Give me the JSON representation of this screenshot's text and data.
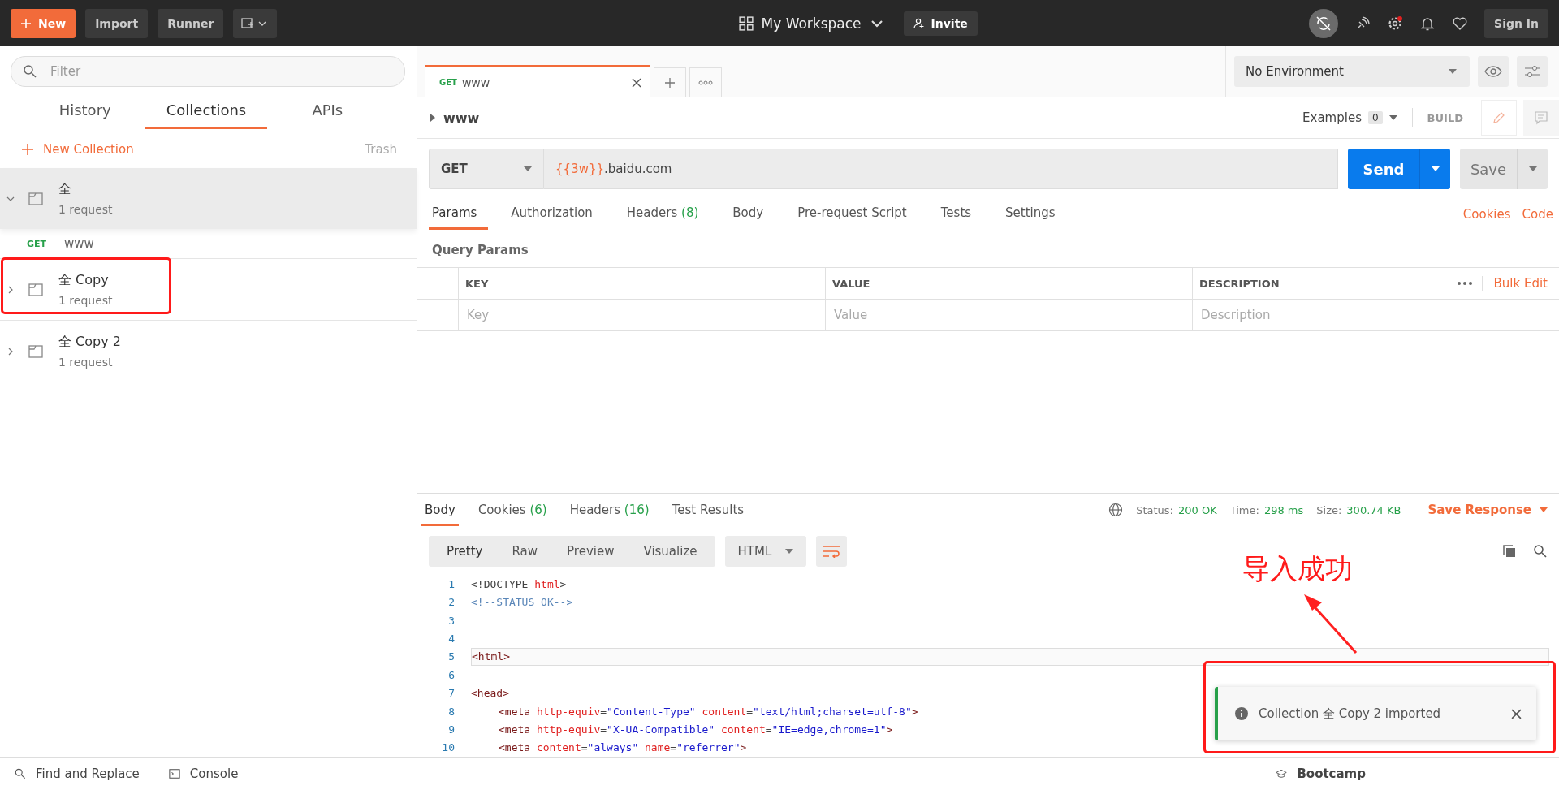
{
  "header": {
    "new_button": "New",
    "import_button": "Import",
    "runner_button": "Runner",
    "workspace": "My Workspace",
    "invite_button": "Invite",
    "sign_in_button": "Sign In"
  },
  "sidebar": {
    "filter_placeholder": "Filter",
    "tabs": [
      {
        "label": "History",
        "selected": false
      },
      {
        "label": "Collections",
        "selected": true
      },
      {
        "label": "APIs",
        "selected": false
      }
    ],
    "new_collection": "New Collection",
    "trash": "Trash",
    "collections": [
      {
        "name": "全",
        "count": "1 request",
        "expanded": true,
        "highlighted": false,
        "requests": [
          {
            "method": "GET",
            "name": "www"
          }
        ]
      },
      {
        "name": "全 Copy",
        "count": "1 request",
        "expanded": false,
        "highlighted": true
      },
      {
        "name": "全 Copy 2",
        "count": "1 request",
        "expanded": false,
        "highlighted": false
      }
    ]
  },
  "request_tabs": [
    {
      "method": "GET",
      "name": "www",
      "selected": true
    }
  ],
  "environment": "No Environment",
  "request": {
    "name": "www",
    "examples_label": "Examples",
    "examples_count": "0",
    "build_label": "BUILD",
    "method": "GET",
    "url_variable": "{{3w}}",
    "url_rest": ".baidu.com",
    "send": "Send",
    "save": "Save"
  },
  "request_sections": [
    {
      "label": "Params",
      "selected": true
    },
    {
      "label": "Authorization",
      "selected": false
    },
    {
      "label": "Headers",
      "count": "(8)",
      "selected": false
    },
    {
      "label": "Body",
      "selected": false
    },
    {
      "label": "Pre-request Script",
      "selected": false
    },
    {
      "label": "Tests",
      "selected": false
    },
    {
      "label": "Settings",
      "selected": false
    }
  ],
  "side_links": [
    "Cookies",
    "Code"
  ],
  "query_params": {
    "title": "Query Params",
    "columns": [
      "KEY",
      "VALUE",
      "DESCRIPTION"
    ],
    "bulk_edit": "Bulk Edit",
    "placeholders": [
      "Key",
      "Value",
      "Description"
    ]
  },
  "response": {
    "tabs": [
      {
        "label": "Body",
        "selected": true
      },
      {
        "label": "Cookies",
        "count": "(6)",
        "selected": false
      },
      {
        "label": "Headers",
        "count": "(16)",
        "selected": false
      },
      {
        "label": "Test Results",
        "selected": false
      }
    ],
    "status_label": "Status:",
    "status": "200 OK",
    "time_label": "Time:",
    "time": "298 ms",
    "size_label": "Size:",
    "size": "300.74 KB",
    "save_response": "Save Response",
    "view_modes": [
      {
        "label": "Pretty",
        "selected": true
      },
      {
        "label": "Raw",
        "selected": false
      },
      {
        "label": "Preview",
        "selected": false
      },
      {
        "label": "Visualize",
        "selected": false
      }
    ],
    "language": "HTML",
    "code_lines": [
      {
        "number": "1",
        "indent": false,
        "highlighted": false,
        "tokens": [
          {
            "kind": "punct",
            "text": "<!DOCTYPE "
          },
          {
            "kind": "keyword",
            "text": "html"
          },
          {
            "kind": "punct",
            "text": ">"
          }
        ]
      },
      {
        "number": "2",
        "indent": false,
        "highlighted": false,
        "tokens": [
          {
            "kind": "comment",
            "text": "<!--STATUS OK-->"
          }
        ]
      },
      {
        "number": "3",
        "indent": false,
        "highlighted": false
      },
      {
        "number": "4",
        "indent": false,
        "highlighted": false
      },
      {
        "number": "5",
        "indent": false,
        "highlighted": true,
        "tokens": [
          {
            "kind": "tag",
            "text": "<html>"
          }
        ]
      },
      {
        "number": "6",
        "indent": false,
        "highlighted": false
      },
      {
        "number": "7",
        "indent": false,
        "highlighted": false,
        "tokens": [
          {
            "kind": "tag",
            "text": "<head>"
          }
        ]
      },
      {
        "number": "8",
        "indent": true,
        "highlighted": false,
        "tokens": [
          {
            "kind": "tag",
            "text": "<meta "
          },
          {
            "kind": "attr",
            "text": "http-equiv"
          },
          {
            "kind": "punct",
            "text": "="
          },
          {
            "kind": "value",
            "text": "\"Content-Type\""
          },
          {
            "kind": "attr",
            "text": " content"
          },
          {
            "kind": "punct",
            "text": "="
          },
          {
            "kind": "value",
            "text": "\"text/html;charset=utf-8\""
          },
          {
            "kind": "tag",
            "text": ">"
          }
        ]
      },
      {
        "number": "9",
        "indent": true,
        "highlighted": false,
        "tokens": [
          {
            "kind": "tag",
            "text": "<meta "
          },
          {
            "kind": "attr",
            "text": "http-equiv"
          },
          {
            "kind": "punct",
            "text": "="
          },
          {
            "kind": "value",
            "text": "\"X-UA-Compatible\""
          },
          {
            "kind": "attr",
            "text": " content"
          },
          {
            "kind": "punct",
            "text": "="
          },
          {
            "kind": "value",
            "text": "\"IE=edge,chrome=1\""
          },
          {
            "kind": "tag",
            "text": ">"
          }
        ]
      },
      {
        "number": "10",
        "indent": true,
        "highlighted": false,
        "tokens": [
          {
            "kind": "tag",
            "text": "<meta "
          },
          {
            "kind": "attr",
            "text": "content"
          },
          {
            "kind": "punct",
            "text": "="
          },
          {
            "kind": "value",
            "text": "\"always\""
          },
          {
            "kind": "attr",
            "text": " name"
          },
          {
            "kind": "punct",
            "text": "="
          },
          {
            "kind": "value",
            "text": "\"referrer\""
          },
          {
            "kind": "tag",
            "text": ">"
          }
        ]
      }
    ]
  },
  "toast": {
    "message": "Collection 全 Copy 2 imported",
    "highlighted": true
  },
  "annotation": {
    "text": "导入成功"
  },
  "footer": {
    "find_replace": "Find and Replace",
    "console": "Console",
    "bootcamp": "Bootcamp"
  }
}
